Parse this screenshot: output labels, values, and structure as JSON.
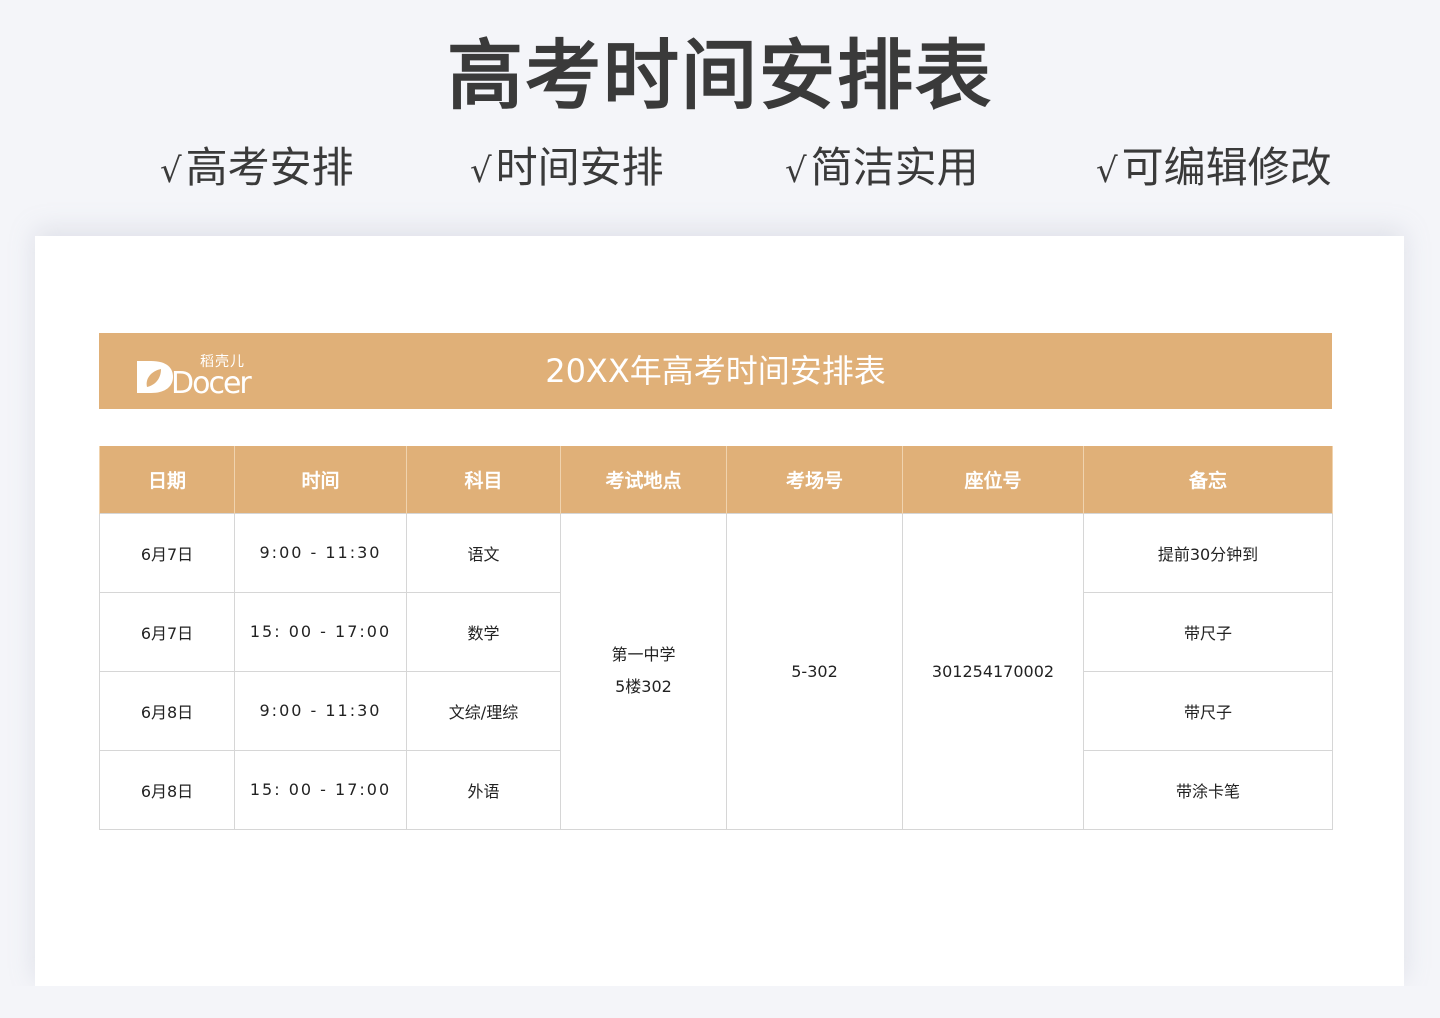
{
  "header": {
    "title": "高考时间安排表",
    "features": [
      "高考安排",
      "时间安排",
      "简洁实用",
      "可编辑修改"
    ],
    "check_mark": "√"
  },
  "banner": {
    "logo_brand": "Docer",
    "logo_cn": "稻壳儿",
    "title": "20XX年高考时间安排表"
  },
  "colors": {
    "accent": "#e0b078",
    "background": "#f4f5f9",
    "title_text": "#3a3a3a"
  },
  "table": {
    "headers": [
      "日期",
      "时间",
      "科目",
      "考试地点",
      "考场号",
      "座位号",
      "备忘"
    ],
    "rows": [
      {
        "date": "6月7日",
        "time": "9:00 - 11:30",
        "subject": "语文",
        "memo": "提前30分钟到"
      },
      {
        "date": "6月7日",
        "time": "15: 00 - 17:00",
        "subject": "数学",
        "memo": "带尺子"
      },
      {
        "date": "6月8日",
        "time": "9:00 - 11:30",
        "subject": "文综/理综",
        "memo": "带尺子"
      },
      {
        "date": "6月8日",
        "time": "15: 00 - 17:00",
        "subject": "外语",
        "memo": "带涂卡笔"
      }
    ],
    "location_line1": "第一中学",
    "location_line2": "5楼302",
    "room": "5-302",
    "seat": "301254170002"
  }
}
